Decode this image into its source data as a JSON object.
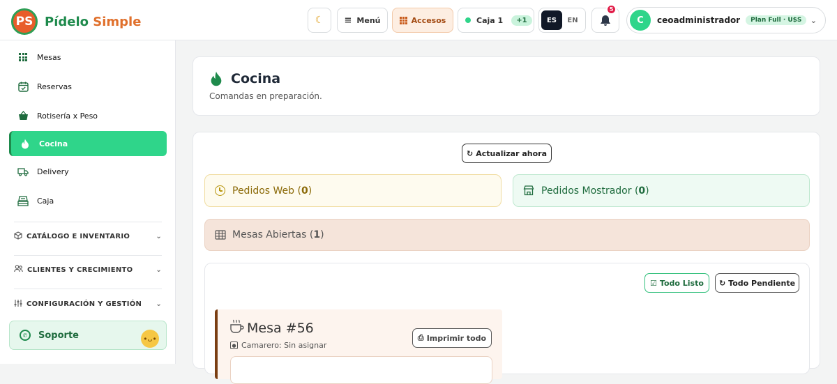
{
  "brand": {
    "initials": "PS",
    "name_a": "Pídelo",
    "name_b": "Simple"
  },
  "topbar": {
    "theme_icon": "moon-icon",
    "menu_label": "Menú",
    "access_label": "Accesos",
    "register_label": "Caja 1",
    "register_badge": "+1",
    "lang_active": "ES",
    "lang_other": "EN",
    "notif_count": "5",
    "user_initial": "C",
    "user_name": "ceoadministrador",
    "plan_badge": "Plan Full · U$S"
  },
  "sidebar": {
    "items": [
      {
        "label": "Mesas",
        "icon": "grid-icon"
      },
      {
        "label": "Reservas",
        "icon": "calendar-icon"
      },
      {
        "label": "Rotisería x Peso",
        "icon": "basket-icon"
      },
      {
        "label": "Cocina",
        "icon": "flame-icon"
      },
      {
        "label": "Delivery",
        "icon": "truck-icon"
      },
      {
        "label": "Caja",
        "icon": "cash-register-icon"
      }
    ],
    "sections": [
      {
        "label": "CATÁLOGO E INVENTARIO"
      },
      {
        "label": "CLIENTES Y CRECIMIENTO"
      },
      {
        "label": "CONFIGURACIÓN Y GESTIÓN"
      }
    ],
    "support_label": "Soporte"
  },
  "page": {
    "title": "Cocina",
    "subtitle": "Comandas en preparación."
  },
  "main": {
    "refresh_label": "Actualizar ahora",
    "web_orders_label": "Pedidos Web (",
    "web_orders_count": "0",
    "counter_orders_label": "Pedidos Mostrador (",
    "counter_orders_count": "0",
    "close_paren": ")",
    "open_tables_label": "Mesas Abiertas (",
    "open_tables_count": "1",
    "all_ready_label": "Todo Listo",
    "all_pending_label": "Todo Pendiente",
    "table_title": "Mesa #56",
    "waiter_label": "Camarero: Sin asignar",
    "print_all_label": "Imprimir todo"
  },
  "colors": {
    "accent": "#2fd58a",
    "brand_green": "#1e8a4c",
    "brand_orange": "#e0702c"
  }
}
